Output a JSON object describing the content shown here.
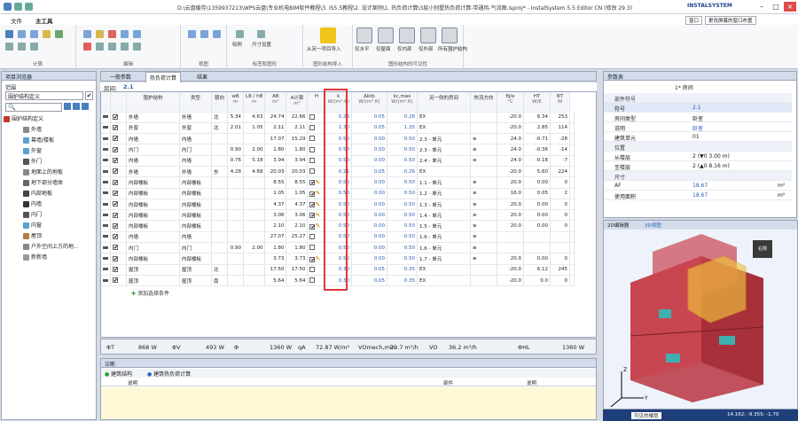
{
  "window": {
    "title": "D:\\云盘缓存\\1359937213\\WPS云盘\\专业机电BIM软件教程\\3. IS5.5教程\\2. 设计案例\\1. 热负荷计算\\3层小别墅热负荷计算-带通风-气流图.isproj* - InstalSystem 5.5 Editor CN (修改 29.3)",
    "brand": "INSTALSYSTEM"
  },
  "menu": {
    "items": [
      "文件",
      "主工具"
    ],
    "active": "主工具",
    "window_btn": "窗口",
    "layout_btn": "更改屏幕的窗口布置"
  },
  "ribbon": {
    "groups": [
      "计算",
      "编辑",
      "视图",
      "标签和图形",
      "图形结构导入",
      "图形结构的可见性"
    ],
    "labels": {
      "snap": "吸附",
      "size": "尺寸设置",
      "import": "从另一项目导入",
      "horizontal": "仅水平",
      "ceiling": "仅屋面",
      "inner": "仅内部",
      "exterior": "仅外部",
      "all": "所有围护结构"
    }
  },
  "left_panel": {
    "title": "项目浏览器",
    "range_label": "范围",
    "filter": "围护结构定义",
    "root": "围护结构定义",
    "items": [
      "外墙",
      "幕墙/楼板",
      "外窗",
      "外门",
      "地面上的地板",
      "地下部分墙体",
      "内部地板",
      "内墙",
      "内门",
      "内窗",
      "屋顶",
      "户外空间上方的地...",
      "新新墙"
    ]
  },
  "tabs": {
    "t1": "一般参数",
    "t2": "热负荷计算",
    "t3": "结果"
  },
  "room": {
    "label": "房间:",
    "value": "2.1"
  },
  "table": {
    "headers": [
      "",
      "",
      "围护结构",
      "类型",
      "朝向",
      "wB",
      "LB / hB",
      "AB",
      "A计算",
      "H",
      "k",
      "Δktb",
      "kc,max",
      "另一侧的房间",
      "热流方向",
      "θj/e",
      "HT",
      "ΦT"
    ],
    "units": [
      "",
      "",
      "",
      "",
      "",
      "m",
      "m",
      "m²",
      "m²",
      "",
      "W/(m²·K)",
      "W/(m²·K)",
      "W/(m²·K)",
      "",
      "",
      "°C",
      "W/K",
      "W"
    ],
    "rows": [
      [
        "外墙",
        "外墙",
        "北",
        "5.34",
        "4.63",
        "24.74",
        "22.66",
        "0",
        "0.23",
        "0.05",
        "0.28",
        "EX",
        "",
        "-20.0",
        "6.34",
        "253",
        "0"
      ],
      [
        "外窗",
        "外窗",
        "北",
        "2.01",
        "1.05",
        "2.11",
        "2.11",
        "0",
        "1.30",
        "0.05",
        "1.35",
        "EX",
        "",
        "-20.0",
        "2.85",
        "114",
        "0"
      ],
      [
        "内墙",
        "内墙",
        "",
        "",
        "",
        "17.07",
        "15.29",
        "0",
        "0.50",
        "0.00",
        "0.50",
        "2.3 - 单元",
        "",
        "24.0",
        "-0.71",
        "-28",
        "0"
      ],
      [
        "内门",
        "内门",
        "",
        "0.90",
        "2.00",
        "1.80",
        "1.80",
        "0",
        "0.50",
        "0.00",
        "0.50",
        "2.3 - 单元",
        "",
        "24.0",
        "-0.36",
        "-14",
        "0"
      ],
      [
        "内墙",
        "内墙",
        "",
        "0.76",
        "5.18",
        "3.94",
        "3.94",
        "0",
        "0.50",
        "0.00",
        "0.50",
        "2.4 - 单元",
        "",
        "24.0",
        "-0.18",
        "-7",
        "0"
      ],
      [
        "外墙",
        "外墙",
        "东",
        "4.28",
        "4.68",
        "20.03",
        "20.03",
        "0",
        "0.21",
        "0.05",
        "0.26",
        "EX",
        "",
        "-20.0",
        "5.60",
        "224",
        "0"
      ],
      [
        "内部楼板",
        "内部楼板",
        "",
        "",
        "",
        "8.55",
        "8.55",
        "1",
        "0.50",
        "0.00",
        "0.50",
        "1.1 - 单元",
        "",
        "20.0",
        "0.00",
        "0",
        "0"
      ],
      [
        "内部楼板",
        "内部楼板",
        "",
        "",
        "",
        "1.05",
        "1.05",
        "1",
        "0.50",
        "0.00",
        "0.50",
        "1.2 - 单元",
        "",
        "16.0",
        "0.05",
        "2",
        "0"
      ],
      [
        "内部楼板",
        "内部楼板",
        "",
        "",
        "",
        "4.37",
        "4.37",
        "1",
        "0.50",
        "0.00",
        "0.50",
        "1.3 - 单元",
        "",
        "20.0",
        "0.00",
        "0",
        "0"
      ],
      [
        "内部楼板",
        "内部楼板",
        "",
        "",
        "",
        "3.06",
        "3.06",
        "1",
        "0.50",
        "0.00",
        "0.50",
        "1.4 - 单元",
        "",
        "20.0",
        "0.00",
        "0",
        "0"
      ],
      [
        "内部楼板",
        "内部楼板",
        "",
        "",
        "",
        "2.10",
        "2.10",
        "1",
        "0.50",
        "0.00",
        "0.50",
        "1.5 - 单元",
        "",
        "20.0",
        "0.00",
        "0",
        "0"
      ],
      [
        "内墙",
        "内墙",
        "",
        "",
        "",
        "27.07",
        "25.27",
        "0",
        "0.50",
        "0.00",
        "0.50",
        "1.6 - 单元",
        "",
        "",
        "",
        "",
        ""
      ],
      [
        "内门",
        "内门",
        "",
        "0.90",
        "2.00",
        "1.80",
        "1.80",
        "0",
        "0.50",
        "0.00",
        "0.50",
        "1.6 - 单元",
        "",
        "",
        "",
        "",
        ""
      ],
      [
        "内部楼板",
        "内部楼板",
        "",
        "",
        "",
        "3.73",
        "3.73",
        "1",
        "0.50",
        "0.00",
        "0.50",
        "1.7 - 单元",
        "",
        "20.0",
        "0.00",
        "0",
        "0"
      ],
      [
        "屋顶",
        "屋顶",
        "北",
        "",
        "",
        "17.50",
        "17.50",
        "0",
        "0.30",
        "0.05",
        "0.35",
        "EX",
        "",
        "-20.0",
        "6.12",
        "245",
        "0"
      ],
      [
        "屋顶",
        "屋顶",
        "南",
        "",
        "",
        "5.64",
        "5.64",
        "0",
        "0.30",
        "0.05",
        "0.35",
        "EX",
        "",
        "-20.0",
        "0.0",
        "0",
        "0"
      ]
    ],
    "add_row": "添加选择条件"
  },
  "summary": {
    "phiT_label": "ΦT",
    "phiT": "868 W",
    "phiV_label": "ΦV",
    "phiV": "493 W",
    "phi_label": "Φ",
    "phi": "1360 W",
    "qA_label": "qA",
    "qA": "72.87 W/m²",
    "vo_label": "VOmech,min",
    "vo": "29.7 m³/h",
    "vo2_label": "VO",
    "vo2": "36.2 m³/h",
    "phiHL_label": "ΦHL",
    "phiHL": "1360 W"
  },
  "diag": {
    "title": "诊断",
    "tab1": "建筑结构",
    "tab2": "建筑热负荷计算",
    "cols": [
      "说明",
      "部件",
      "说明"
    ]
  },
  "props": {
    "title": "参数表",
    "subtitle": "1* 房间",
    "sections": [
      "部件符号",
      "位置",
      "尺寸"
    ],
    "rows": [
      [
        "符号",
        "2.1"
      ],
      [
        "房间类型",
        "卧室"
      ],
      [
        "说明",
        "卧室"
      ],
      [
        "建筑单元",
        "01"
      ],
      [
        "从楼层",
        "2 (▼0  3.00 m)"
      ],
      [
        "至楼层",
        "2 (▲0  8.16 m)"
      ],
      [
        "AF",
        "18.67"
      ],
      [
        "使用面积",
        "18.67"
      ]
    ],
    "units": {
      "AF": "m²",
      "used": "m²"
    }
  },
  "view3d": {
    "tab1": "2D编辑器",
    "tab2": "3D视图",
    "cube": "右侧"
  },
  "status": {
    "visible": "可见的楼层",
    "coords": "14.162; -9.355; -1.70"
  }
}
